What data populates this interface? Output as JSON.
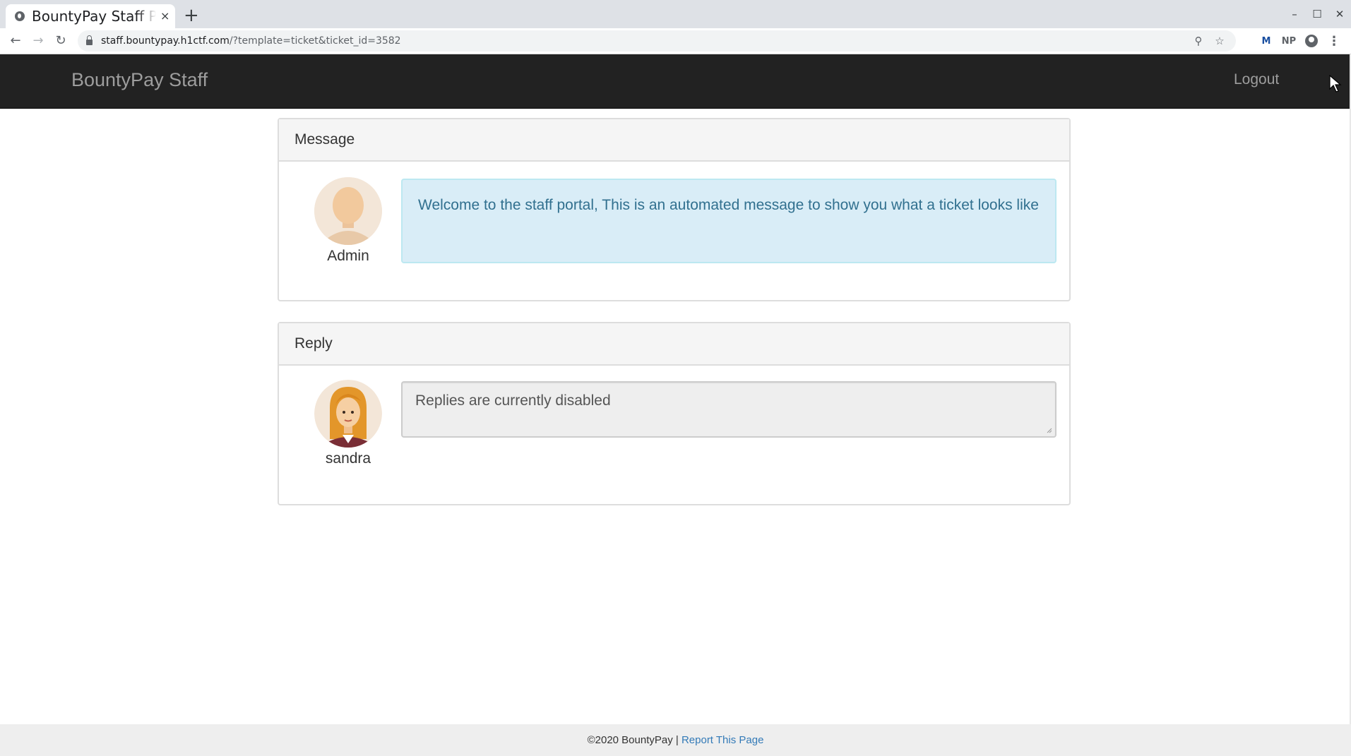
{
  "browser": {
    "tab_title": "BountyPay Staff Portal",
    "tab_close": "×",
    "new_tab": "+",
    "url_host": "staff.bountypay.h1ctf.com",
    "url_path": "/?template=ticket&ticket_id=3582",
    "back": "←",
    "forward": "→",
    "reload": "↻",
    "zoom_icon": "⚲",
    "star_icon": "☆",
    "ext1": "M",
    "ext2": "NP",
    "menu_icon": "⋮",
    "minimize": "–",
    "maximize": "☐",
    "close": "✕"
  },
  "navbar": {
    "brand": "BountyPay Staff",
    "logout": "Logout"
  },
  "message_panel": {
    "title": "Message",
    "author": "Admin",
    "text": "Welcome to the staff portal, This is an automated message to show you what a ticket looks like"
  },
  "reply_panel": {
    "title": "Reply",
    "author": "sandra",
    "placeholder": "Replies are currently disabled"
  },
  "footer": {
    "copyright": "©2020 BountyPay | ",
    "report_link": "Report This Page"
  },
  "colors": {
    "navbar_bg": "#222222",
    "alert_bg": "#d9edf7",
    "alert_text": "#31708f",
    "link": "#337ab7"
  }
}
